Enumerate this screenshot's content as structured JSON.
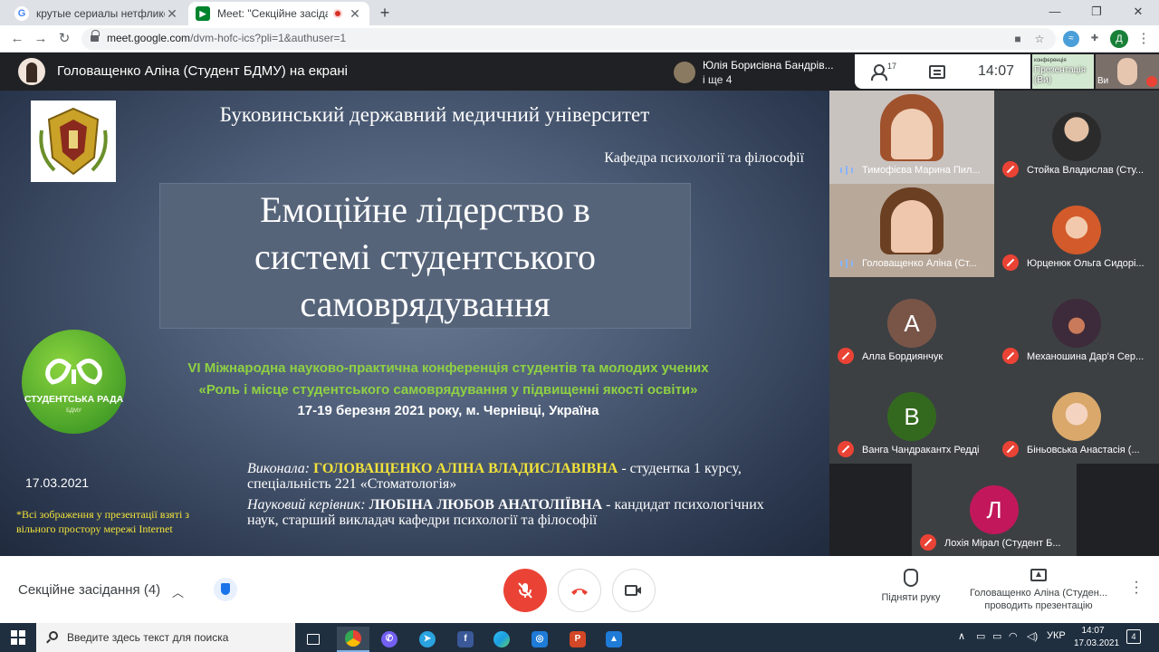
{
  "browser": {
    "tabs": [
      {
        "title": "крутые сериалы нетфликс - Пои",
        "favicon": "google-icon"
      },
      {
        "title": "Meet: \"Секційне засідання (",
        "favicon": "meet-icon",
        "recording": true
      }
    ],
    "url_host": "meet.google.com",
    "url_path": "/dvm-hofc-ics?pli=1&authuser=1",
    "profile_initial": "Д"
  },
  "meet_top": {
    "presenting": "Головащенко Аліна (Студент БДМУ) на екрані",
    "speaker_name": "Юлія Борисівна Бандрів...",
    "speaker_more": "і ще 4",
    "people_count": "17",
    "time": "14:07",
    "self_label": "Презентація (Ви)",
    "self_tiny": "конференція",
    "you_label": "Ви"
  },
  "slide": {
    "university": "Буковинський державний медичний університет",
    "department": "Кафедра психології та філософії",
    "title_lines": [
      "Емоційне лідерство в",
      "системі студентського",
      "самоврядування"
    ],
    "logo_text": "СТУДЕНТСЬКА РАДА",
    "logo_sub": "БДМУ",
    "conf_line1": "VI Міжнародна науково-практична конференція студентів та молодих учених",
    "conf_line2": "«Роль і місце студентського самоврядування у підвищенні якості освіти»",
    "conf_line3": "17-19 березня 2021 року, м. Чернівці, Україна",
    "date": "17.03.2021",
    "note": "*Всі зображення у презентації взяті з вільного простору  мережі Internet",
    "author_label": "Виконала:",
    "author_name": "ГОЛОВАЩЕНКО АЛІНА ВЛАДИСЛАВІВНА",
    "author_rest": " - студентка 1 курсу, спеціальність 221 «Стоматологія»",
    "advisor_label": "Науковий керівник:",
    "advisor_name": "ЛЮБІНА ЛЮБОВ АНАТОЛІЇВНА",
    "advisor_rest": " - кандидат психологічних наук, старший викладач кафедри психології та філософії"
  },
  "participants": [
    {
      "name": "Тимофієва Марина Пил...",
      "status": "speaking",
      "kind": "video"
    },
    {
      "name": "Стойка Владислав (Сту...",
      "status": "muted",
      "kind": "photo"
    },
    {
      "name": "Головащенко Аліна (Ст...",
      "status": "speaking",
      "kind": "video"
    },
    {
      "name": "Юрценюк Ольга Сидорі...",
      "status": "muted",
      "kind": "photo"
    },
    {
      "name": "Алла Бордиянчук",
      "status": "muted",
      "kind": "letter",
      "letter": "А",
      "color": "#795548"
    },
    {
      "name": "Механошина Дар'я Сер...",
      "status": "muted",
      "kind": "photo"
    },
    {
      "name": "Ванга Чандракантх Редді",
      "status": "muted",
      "kind": "letter",
      "letter": "В",
      "color": "#33691e"
    },
    {
      "name": "Біньовська Анастасія (...",
      "status": "muted",
      "kind": "photo"
    },
    {
      "name": "Лохія Мірал (Студент Б...",
      "status": "muted",
      "kind": "letter",
      "letter": "Л",
      "color": "#c2185b"
    }
  ],
  "meet_bottom": {
    "meeting_name": "Секційне засідання (4)",
    "raise_hand": "Підняти руку",
    "presenter_line1": "Головащенко Аліна (Студен...",
    "presenter_line2": "проводить презентацію"
  },
  "taskbar": {
    "search_placeholder": "Введите здесь текст для поиска",
    "lang": "УКР",
    "time": "14:07",
    "date": "17.03.2021",
    "notifications": "4"
  },
  "colors": {
    "accent_red": "#ea4335",
    "meet_dark": "#202124",
    "slide_green": "#8ed143",
    "slide_yellow": "#f2e23a"
  }
}
